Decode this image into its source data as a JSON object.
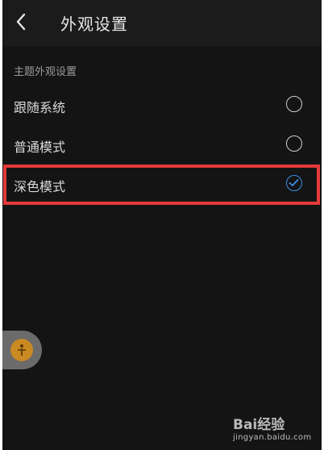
{
  "header": {
    "title": "外观设置"
  },
  "section": {
    "label": "主题外观设置"
  },
  "options": [
    {
      "label": "跟随系统",
      "selected": false
    },
    {
      "label": "普通模式",
      "selected": false
    },
    {
      "label": "深色模式",
      "selected": true
    }
  ],
  "colors": {
    "background": "#141414",
    "header": "#1b1b1b",
    "accent": "#3d8ee8",
    "highlight_box": "#e53a3a"
  },
  "watermark": {
    "logo": "Bai经验",
    "url": "jingyan.baidu.com"
  }
}
